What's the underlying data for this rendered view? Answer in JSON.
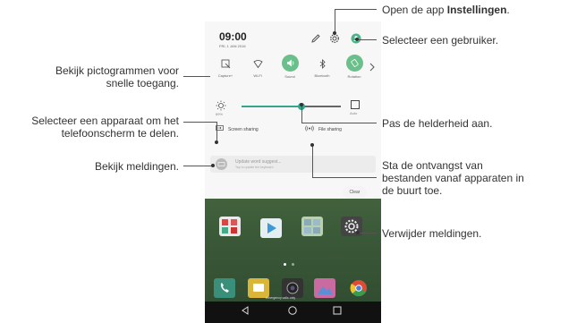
{
  "status": {
    "time": "09:00",
    "date": "FRI, 1 JAN 2016"
  },
  "quick_settings": [
    {
      "label": "Capture+",
      "icon": "capture-icon",
      "on": false
    },
    {
      "label": "Wi-Fi",
      "icon": "wifi-icon",
      "on": false
    },
    {
      "label": "Sound",
      "icon": "sound-icon",
      "on": true
    },
    {
      "label": "Bluetooth",
      "icon": "bluetooth-icon",
      "on": false
    },
    {
      "label": "Rotation",
      "icon": "rotation-icon",
      "on": true
    }
  ],
  "brightness": {
    "label": "89%",
    "auto_label": "Auto",
    "level_percent": 60
  },
  "share": {
    "screen_sharing": "Screen sharing",
    "file_sharing": "File sharing"
  },
  "notification": {
    "title": "Update word suggest...",
    "subtitle": "Tap to update the keyboard"
  },
  "clear_label": "Clear",
  "home_label": "Emergency calls only",
  "colors": {
    "accent": "#36a58c",
    "toggle_on": "#6bbf8a"
  },
  "callouts": {
    "settings_prefix": "Open de app ",
    "settings_bold": "Instellingen",
    "settings_suffix": ".",
    "user": "Selecteer een gebruiker.",
    "quick_line1": "Bekijk pictogrammen voor",
    "quick_line2": "snelle toegang.",
    "brightness": "Pas de helderheid aan.",
    "screen_line1": "Selecteer een apparaat om het",
    "screen_line2": "telefoonscherm te delen.",
    "notifications": "Bekijk meldingen.",
    "file_line1": "Sta de ontvangst van",
    "file_line2": "bestanden vanaf apparaten in",
    "file_line3": "de buurt toe.",
    "clear": "Verwijder meldingen."
  }
}
